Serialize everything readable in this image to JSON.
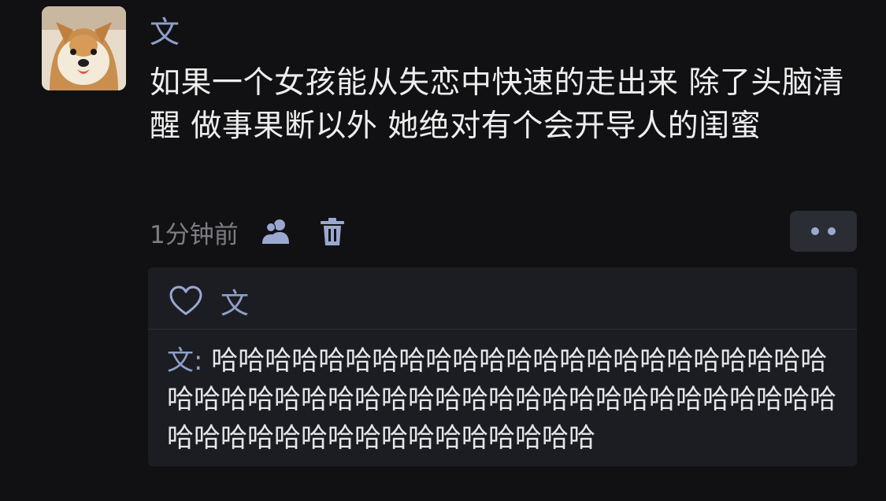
{
  "post": {
    "author": "文",
    "text": "如果一个女孩能从失恋中快速的走出来 除了头脑清醒 做事果断以外 她绝对有个会开导人的闺蜜",
    "time": "1分钟前"
  },
  "icons": {
    "avatar": "shiba-dog-avatar",
    "friends": "friends-visibility-icon",
    "delete": "trash-icon",
    "more": "more-dots-icon",
    "like": "heart-icon"
  },
  "likes": {
    "names": "文"
  },
  "comments": [
    {
      "author": "文:",
      "text": "哈哈哈哈哈哈哈哈哈哈哈哈哈哈哈哈哈哈哈哈哈哈哈哈哈哈哈哈哈哈哈哈哈哈哈哈哈哈哈哈哈哈哈哈哈哈哈哈哈哈哈哈哈哈哈哈哈哈哈哈哈哈哈哈"
    }
  ],
  "colors": {
    "background": "#111113",
    "accent_name": "#8ea0c8",
    "panel": "#1c1d22",
    "meta": "#7d7d82"
  }
}
